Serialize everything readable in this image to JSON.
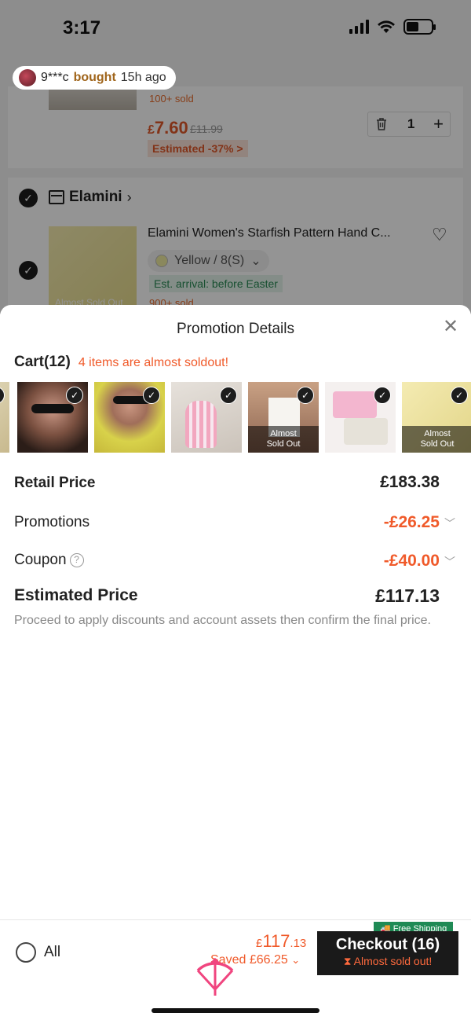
{
  "status_bar": {
    "time": "3:17"
  },
  "ticker": {
    "name": "9***c",
    "verb": "bought",
    "ago": "15h ago"
  },
  "bg_item1": {
    "sold": "100+ sold",
    "price_currency": "£",
    "price_main": "7.60",
    "old_price": "£11.99",
    "estimated": "Estimated -37% >",
    "qty": "1"
  },
  "bg_store": {
    "name": "Elamini",
    "item_title": "Elamini Women's Starfish Pattern Hand C...",
    "variant": "Yellow / 8(S)",
    "arrival": "Est. arrival: before Easter",
    "sold": "900+ sold",
    "almost": "Almost Sold Out"
  },
  "sheet": {
    "title": "Promotion Details",
    "close": "✕",
    "cart_label": "Cart(12)",
    "cart_warning": "4 items are almost soldout!",
    "almost_tag_1": "Almost",
    "almost_tag_2": "Sold Out",
    "retail_label": "Retail Price",
    "retail_value": "£183.38",
    "promotions_label": "Promotions",
    "promotions_value": "-£26.25",
    "coupon_label": "Coupon",
    "coupon_value": "-£40.00",
    "estimated_label": "Estimated Price",
    "estimated_value": "£117.13",
    "note": "Proceed to apply discounts and account assets then confirm the final price."
  },
  "bottom": {
    "all_label": "All",
    "total_currency": "£",
    "total_main": "117",
    "total_dec": ".13",
    "saved": "Saved £66.25",
    "checkout": "Checkout (16)",
    "checkout_sub": "Almost sold out!",
    "free_shipping": "Free Shipping"
  },
  "colors": {
    "accent": "#f05a2a",
    "dark": "#1a1a1a",
    "green": "#1f8a55"
  }
}
